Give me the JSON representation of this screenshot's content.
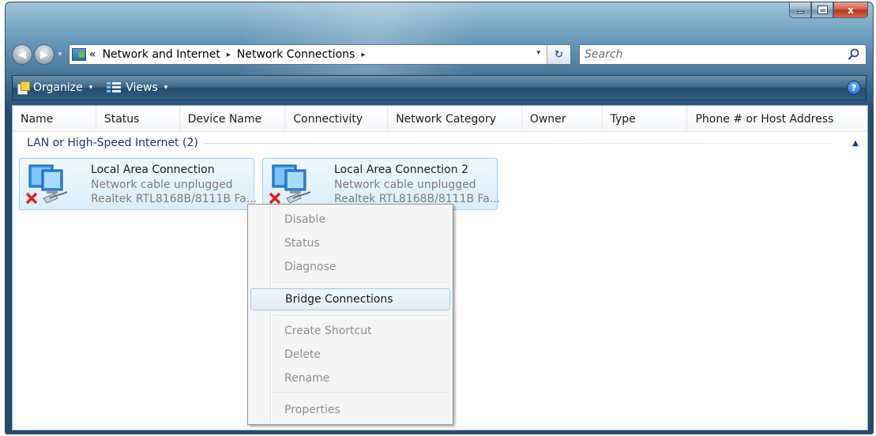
{
  "window": {
    "caption_buttons": {
      "minimize_icon": "minimize-icon",
      "maximize_icon": "maximize-icon",
      "close_icon": "close-icon",
      "close_glyph": "x"
    }
  },
  "address_bar": {
    "overflow_marker": "«",
    "breadcrumbs": [
      "Network and Internet",
      "Network Connections"
    ],
    "separator": "▸",
    "dropdown_glyph": "▾"
  },
  "search": {
    "placeholder": "Search"
  },
  "toolbar": {
    "organize_label": "Organize",
    "views_label": "Views",
    "help_glyph": "?"
  },
  "columns": [
    {
      "label": "Name"
    },
    {
      "label": "Status"
    },
    {
      "label": "Device Name"
    },
    {
      "label": "Connectivity"
    },
    {
      "label": "Network Category"
    },
    {
      "label": "Owner"
    },
    {
      "label": "Type"
    },
    {
      "label": "Phone # or Host Address"
    }
  ],
  "group": {
    "label": "LAN or High-Speed Internet (2)",
    "collapse_glyph": "▲"
  },
  "connections": [
    {
      "name": "Local Area Connection",
      "status": "Network cable unplugged",
      "device": "Realtek RTL8168B/8111B Fa..."
    },
    {
      "name": "Local Area Connection 2",
      "status": "Network cable unplugged",
      "device": "Realtek RTL8168B/8111B Fa..."
    }
  ],
  "context_menu": {
    "items": [
      {
        "label": "Disable",
        "enabled": false
      },
      {
        "label": "Status",
        "enabled": false
      },
      {
        "label": "Diagnose",
        "enabled": false
      },
      {
        "label": "Bridge Connections",
        "enabled": true,
        "highlighted": true
      },
      {
        "label": "Create Shortcut",
        "enabled": false
      },
      {
        "label": "Delete",
        "enabled": false
      },
      {
        "label": "Rename",
        "enabled": false
      },
      {
        "label": "Properties",
        "enabled": false
      }
    ]
  },
  "colors": {
    "group_header": "#1e3287",
    "selection_fill": "#d9eefb",
    "selection_border": "#9fcfef",
    "disabled_text": "#8d8d8d",
    "toolbar": "#2e5d80"
  }
}
